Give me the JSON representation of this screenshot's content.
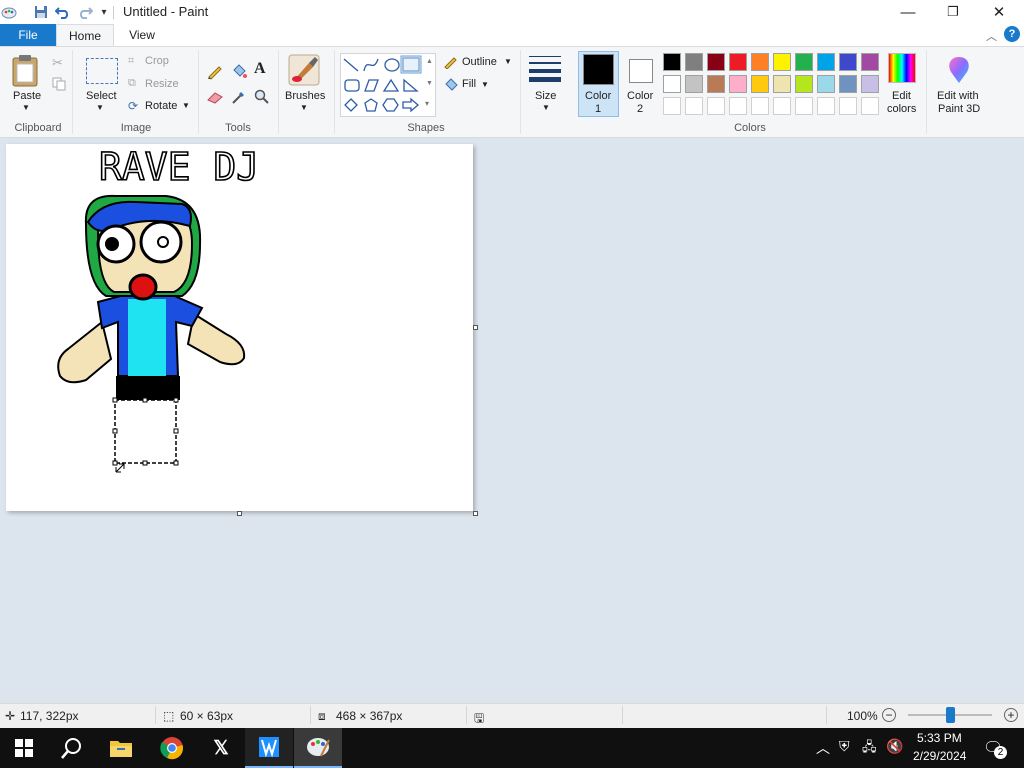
{
  "window": {
    "title": "Untitled - Paint",
    "minimize_glyph": "—",
    "restore_glyph": "❐",
    "close_glyph": "✕"
  },
  "menu": {
    "file": "File",
    "home": "Home",
    "view": "View"
  },
  "clipboard": {
    "paste": "Paste",
    "group": "Clipboard"
  },
  "image": {
    "select": "Select",
    "crop": "Crop",
    "resize": "Resize",
    "rotate": "Rotate",
    "group": "Image"
  },
  "tools": {
    "group": "Tools",
    "text_glyph": "A"
  },
  "brushes": {
    "label": "Brushes"
  },
  "shapes": {
    "outline": "Outline",
    "fill": "Fill",
    "group": "Shapes"
  },
  "size": {
    "label": "Size"
  },
  "colors": {
    "color1_line1": "Color",
    "color1_line2": "1",
    "color2_line1": "Color",
    "color2_line2": "2",
    "edit_line1": "Edit",
    "edit_line2": "colors",
    "paint3d_line1": "Edit with",
    "paint3d_line2": "Paint 3D",
    "group": "Colors",
    "color1_value": "#000000",
    "color2_value": "#ffffff",
    "palette_row1": [
      "#000000",
      "#7f7f7f",
      "#880015",
      "#ed1c24",
      "#ff7f27",
      "#fff200",
      "#22b14c",
      "#00a2e8",
      "#3f48cc",
      "#a349a4"
    ],
    "palette_row2": [
      "#ffffff",
      "#c3c3c3",
      "#b97a57",
      "#ffaec9",
      "#ffc90e",
      "#efe4b0",
      "#b5e61d",
      "#99d9ea",
      "#7092be",
      "#c8bfe7"
    ]
  },
  "canvas": {
    "drawing_title": "RAVE DJ"
  },
  "status": {
    "cursor_pos": "117, 322px",
    "selection_size": "60 × 63px",
    "image_size": "468 × 367px",
    "zoom": "100%"
  },
  "taskbar": {
    "time": "5:33 PM",
    "date": "2/29/2024",
    "notification_count": "2"
  }
}
